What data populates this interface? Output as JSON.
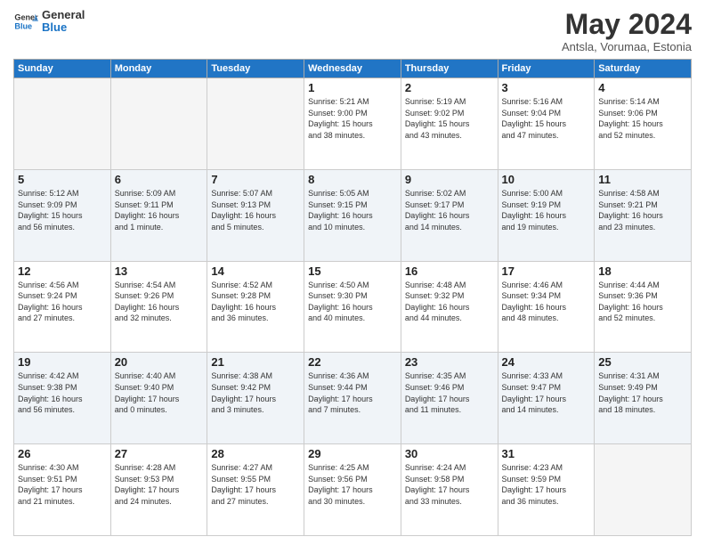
{
  "header": {
    "logo_line1": "General",
    "logo_line2": "Blue",
    "month_title": "May 2024",
    "subtitle": "Antsla, Vorumaa, Estonia"
  },
  "weekdays": [
    "Sunday",
    "Monday",
    "Tuesday",
    "Wednesday",
    "Thursday",
    "Friday",
    "Saturday"
  ],
  "weeks": [
    [
      {
        "day": "",
        "info": ""
      },
      {
        "day": "",
        "info": ""
      },
      {
        "day": "",
        "info": ""
      },
      {
        "day": "1",
        "info": "Sunrise: 5:21 AM\nSunset: 9:00 PM\nDaylight: 15 hours\nand 38 minutes."
      },
      {
        "day": "2",
        "info": "Sunrise: 5:19 AM\nSunset: 9:02 PM\nDaylight: 15 hours\nand 43 minutes."
      },
      {
        "day": "3",
        "info": "Sunrise: 5:16 AM\nSunset: 9:04 PM\nDaylight: 15 hours\nand 47 minutes."
      },
      {
        "day": "4",
        "info": "Sunrise: 5:14 AM\nSunset: 9:06 PM\nDaylight: 15 hours\nand 52 minutes."
      }
    ],
    [
      {
        "day": "5",
        "info": "Sunrise: 5:12 AM\nSunset: 9:09 PM\nDaylight: 15 hours\nand 56 minutes."
      },
      {
        "day": "6",
        "info": "Sunrise: 5:09 AM\nSunset: 9:11 PM\nDaylight: 16 hours\nand 1 minute."
      },
      {
        "day": "7",
        "info": "Sunrise: 5:07 AM\nSunset: 9:13 PM\nDaylight: 16 hours\nand 5 minutes."
      },
      {
        "day": "8",
        "info": "Sunrise: 5:05 AM\nSunset: 9:15 PM\nDaylight: 16 hours\nand 10 minutes."
      },
      {
        "day": "9",
        "info": "Sunrise: 5:02 AM\nSunset: 9:17 PM\nDaylight: 16 hours\nand 14 minutes."
      },
      {
        "day": "10",
        "info": "Sunrise: 5:00 AM\nSunset: 9:19 PM\nDaylight: 16 hours\nand 19 minutes."
      },
      {
        "day": "11",
        "info": "Sunrise: 4:58 AM\nSunset: 9:21 PM\nDaylight: 16 hours\nand 23 minutes."
      }
    ],
    [
      {
        "day": "12",
        "info": "Sunrise: 4:56 AM\nSunset: 9:24 PM\nDaylight: 16 hours\nand 27 minutes."
      },
      {
        "day": "13",
        "info": "Sunrise: 4:54 AM\nSunset: 9:26 PM\nDaylight: 16 hours\nand 32 minutes."
      },
      {
        "day": "14",
        "info": "Sunrise: 4:52 AM\nSunset: 9:28 PM\nDaylight: 16 hours\nand 36 minutes."
      },
      {
        "day": "15",
        "info": "Sunrise: 4:50 AM\nSunset: 9:30 PM\nDaylight: 16 hours\nand 40 minutes."
      },
      {
        "day": "16",
        "info": "Sunrise: 4:48 AM\nSunset: 9:32 PM\nDaylight: 16 hours\nand 44 minutes."
      },
      {
        "day": "17",
        "info": "Sunrise: 4:46 AM\nSunset: 9:34 PM\nDaylight: 16 hours\nand 48 minutes."
      },
      {
        "day": "18",
        "info": "Sunrise: 4:44 AM\nSunset: 9:36 PM\nDaylight: 16 hours\nand 52 minutes."
      }
    ],
    [
      {
        "day": "19",
        "info": "Sunrise: 4:42 AM\nSunset: 9:38 PM\nDaylight: 16 hours\nand 56 minutes."
      },
      {
        "day": "20",
        "info": "Sunrise: 4:40 AM\nSunset: 9:40 PM\nDaylight: 17 hours\nand 0 minutes."
      },
      {
        "day": "21",
        "info": "Sunrise: 4:38 AM\nSunset: 9:42 PM\nDaylight: 17 hours\nand 3 minutes."
      },
      {
        "day": "22",
        "info": "Sunrise: 4:36 AM\nSunset: 9:44 PM\nDaylight: 17 hours\nand 7 minutes."
      },
      {
        "day": "23",
        "info": "Sunrise: 4:35 AM\nSunset: 9:46 PM\nDaylight: 17 hours\nand 11 minutes."
      },
      {
        "day": "24",
        "info": "Sunrise: 4:33 AM\nSunset: 9:47 PM\nDaylight: 17 hours\nand 14 minutes."
      },
      {
        "day": "25",
        "info": "Sunrise: 4:31 AM\nSunset: 9:49 PM\nDaylight: 17 hours\nand 18 minutes."
      }
    ],
    [
      {
        "day": "26",
        "info": "Sunrise: 4:30 AM\nSunset: 9:51 PM\nDaylight: 17 hours\nand 21 minutes."
      },
      {
        "day": "27",
        "info": "Sunrise: 4:28 AM\nSunset: 9:53 PM\nDaylight: 17 hours\nand 24 minutes."
      },
      {
        "day": "28",
        "info": "Sunrise: 4:27 AM\nSunset: 9:55 PM\nDaylight: 17 hours\nand 27 minutes."
      },
      {
        "day": "29",
        "info": "Sunrise: 4:25 AM\nSunset: 9:56 PM\nDaylight: 17 hours\nand 30 minutes."
      },
      {
        "day": "30",
        "info": "Sunrise: 4:24 AM\nSunset: 9:58 PM\nDaylight: 17 hours\nand 33 minutes."
      },
      {
        "day": "31",
        "info": "Sunrise: 4:23 AM\nSunset: 9:59 PM\nDaylight: 17 hours\nand 36 minutes."
      },
      {
        "day": "",
        "info": ""
      }
    ]
  ]
}
